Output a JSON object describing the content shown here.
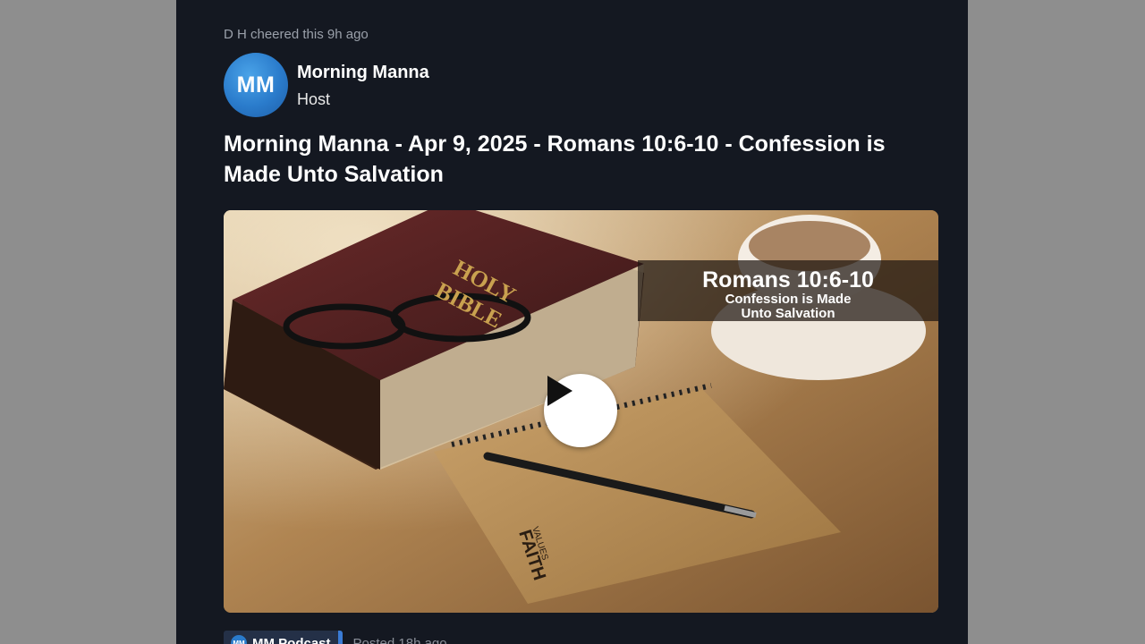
{
  "post": {
    "activity": "D H cheered this 9h ago",
    "avatar_initials": "MM",
    "author_name": "Morning Manna",
    "author_role": "Host",
    "title": "Morning Manna - Apr 9, 2025 - Romans 10:6-10 - Confession is Made Unto Salvation"
  },
  "media": {
    "banner_title": "Romans 10:6-10",
    "banner_line1": "Confession is Made",
    "banner_line2": "Unto Salvation",
    "bible_text_1": "HOLY",
    "bible_text_2": "BIBLE",
    "notebook_text_1": "FAITH",
    "notebook_text_2": "VALUES",
    "play_icon": "play-icon"
  },
  "footer": {
    "channel_label": "MM Podcast",
    "posted": "Posted 18h ago"
  },
  "colors": {
    "page_bg": "#8e8e8e",
    "panel_bg": "#141821",
    "avatar": "#2a7bcb",
    "chip_bg": "#243047",
    "chip_accent": "#3a7bd5"
  }
}
